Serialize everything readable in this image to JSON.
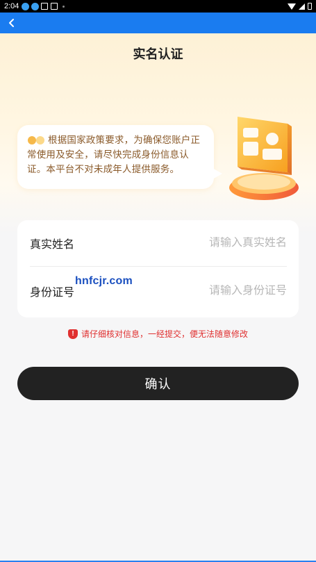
{
  "status_bar": {
    "time": "2:04"
  },
  "page": {
    "title": "实名认证"
  },
  "notice": {
    "text": "根据国家政策要求，为确保您账户正常使用及安全，请尽快完成身份信息认证。本平台不对未成年人提供服务。"
  },
  "form": {
    "name_label": "真实姓名",
    "name_placeholder": "请输入真实姓名",
    "name_value": "",
    "id_label": "身份证号",
    "id_placeholder": "请输入身份证号",
    "id_value": ""
  },
  "watermark": "hnfcjr.com",
  "warning": {
    "icon": "!",
    "text": "请仔细核对信息，一经提交，便无法随意修改"
  },
  "confirm": {
    "label": "确认"
  },
  "colors": {
    "app_bar": "#1a7cf0",
    "button": "#222222",
    "warning": "#e03030",
    "notice_text": "#8a5a2a"
  }
}
